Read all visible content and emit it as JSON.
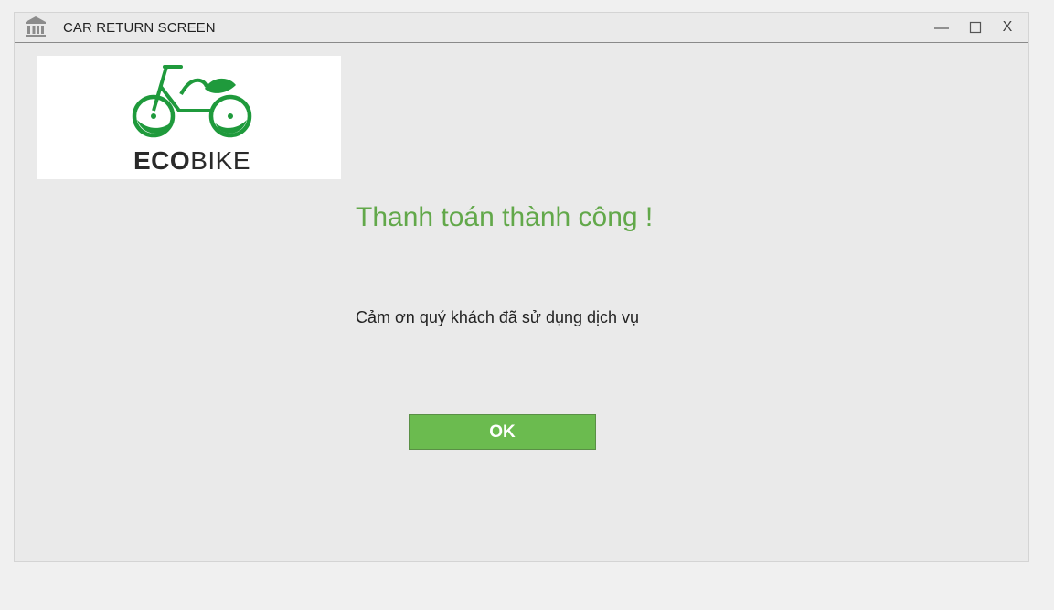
{
  "window": {
    "title": "CAR RETURN SCREEN",
    "controls": {
      "minimize": "—",
      "maximize": "☐",
      "close": "X"
    }
  },
  "logo": {
    "brand_part1": "ECO",
    "brand_part2": "BIKE",
    "icon": "bicycle-leaf-logo"
  },
  "main": {
    "title": "Thanh toán thành công !",
    "message": "Cảm ơn quý khách đã sử dụng dịch vụ",
    "ok_label": "OK"
  },
  "colors": {
    "accent_green": "#6bbb4f",
    "title_green": "#62a84a",
    "logo_green": "#1f9a3c"
  }
}
